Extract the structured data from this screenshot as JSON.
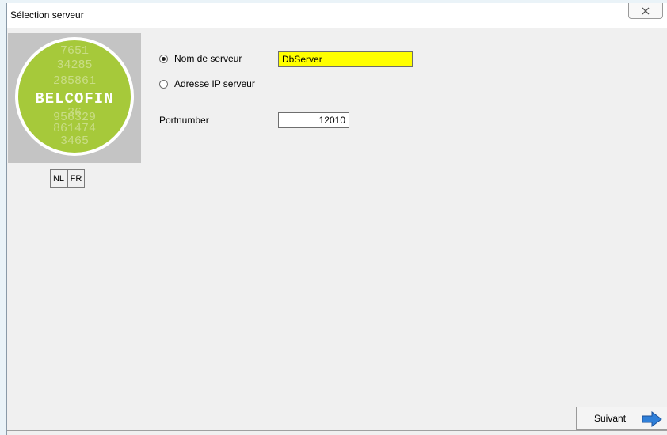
{
  "window": {
    "title": "Sélection serveur"
  },
  "logo": {
    "brand_text": "BELCOFIN",
    "digit_rows": [
      "7651",
      "34285",
      "285861",
      "36",
      "956329",
      "861474",
      "3465"
    ]
  },
  "language": {
    "nl_label": "NL",
    "fr_label": "FR"
  },
  "server": {
    "option_name_label": "Nom de serveur",
    "option_ip_label": "Adresse IP serveur",
    "selected_option": "Nom de serveur",
    "name_value": "DbServer"
  },
  "port": {
    "label": "Portnumber",
    "value": "12010"
  },
  "footer": {
    "next_label": "Suivant"
  },
  "colors": {
    "server_field_bg": "#ffff00",
    "logo_green": "#a6c93a",
    "arrow_blue": "#2f7fd8"
  }
}
